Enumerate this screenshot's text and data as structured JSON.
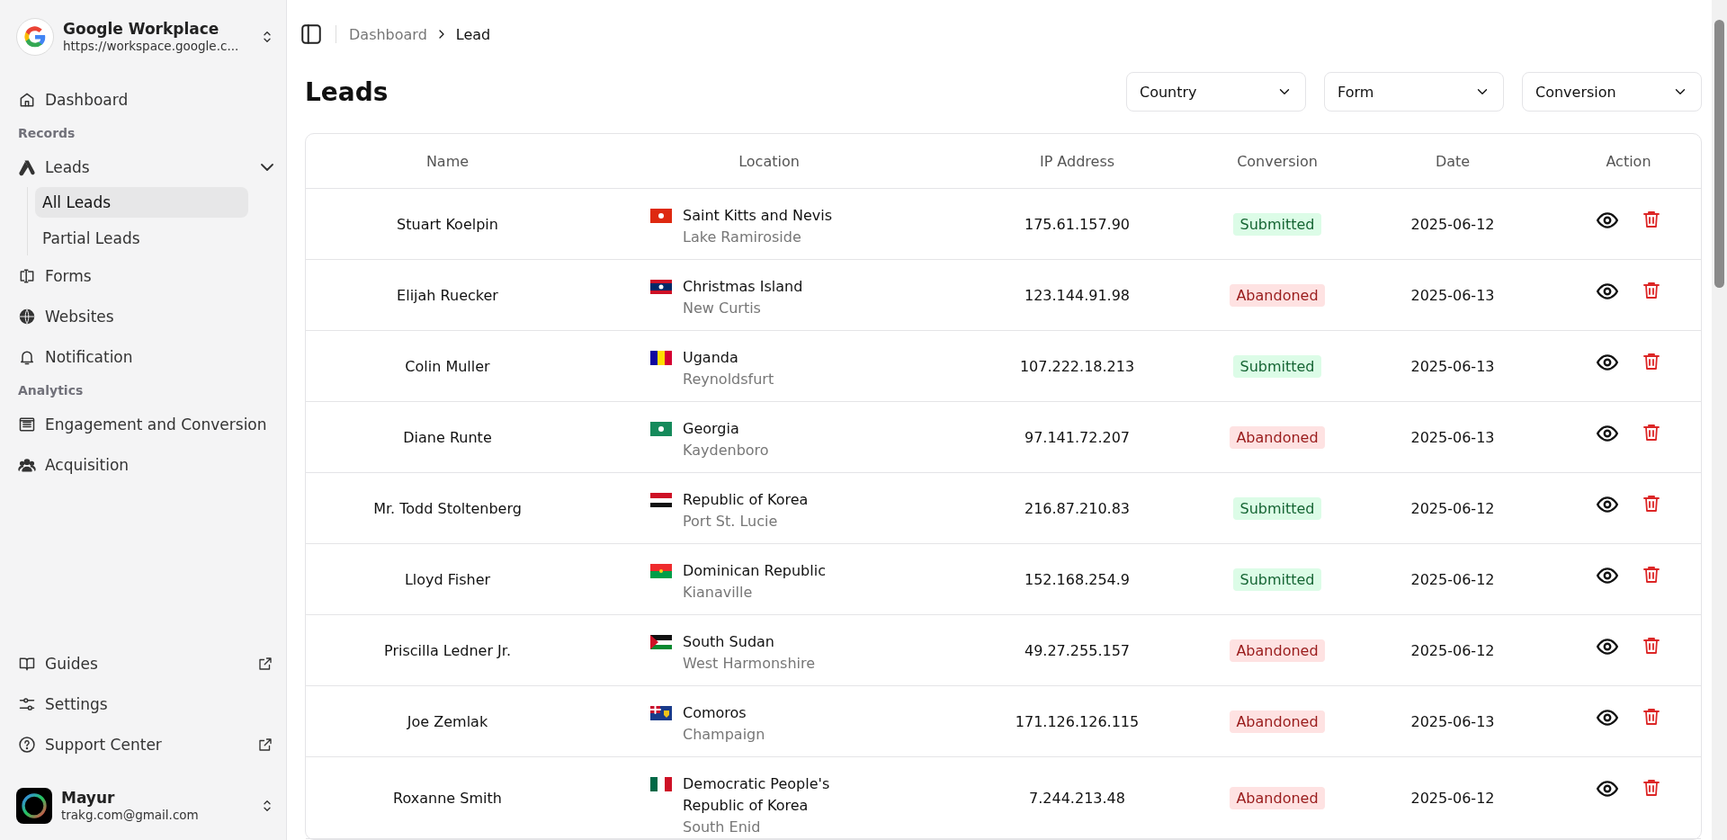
{
  "workspace": {
    "name": "Google Workplace",
    "url": "https://workspace.google.c..."
  },
  "nav": [
    {
      "kind": "item",
      "label": "Dashboard",
      "selected": false
    },
    {
      "kind": "section",
      "label": "Records"
    },
    {
      "kind": "group",
      "label": "Leads",
      "expanded": true,
      "children": [
        {
          "label": "All Leads",
          "selected": true
        },
        {
          "label": "Partial Leads",
          "selected": false
        }
      ]
    },
    {
      "kind": "item",
      "label": "Forms",
      "selected": false
    },
    {
      "kind": "item",
      "label": "Websites",
      "selected": false
    },
    {
      "kind": "item",
      "label": "Notification",
      "selected": false
    },
    {
      "kind": "section",
      "label": "Analytics"
    },
    {
      "kind": "item",
      "label": "Engagement and Conversion",
      "selected": false
    },
    {
      "kind": "item",
      "label": "Acquisition",
      "selected": false
    }
  ],
  "footer_nav": [
    {
      "label": "Guides",
      "external": true
    },
    {
      "label": "Settings",
      "external": false
    },
    {
      "label": "Support Center",
      "external": true
    }
  ],
  "user": {
    "name": "Mayur",
    "email": "trakg.com@gmail.com"
  },
  "breadcrumb": [
    "Dashboard",
    "Lead"
  ],
  "page_title": "Leads",
  "filters": [
    {
      "label": "Country"
    },
    {
      "label": "Form"
    },
    {
      "label": "Conversion"
    }
  ],
  "table": {
    "columns": [
      "Name",
      "Location",
      "IP Address",
      "Conversion",
      "Date",
      "Action"
    ],
    "rows": [
      {
        "name": "Stuart Koelpin",
        "country": "Saint Kitts and Nevis",
        "city": "Lake Ramiroside",
        "ip": "175.61.157.90",
        "conversion": {
          "label": "Submitted",
          "kind": "submitted"
        },
        "date": "2025-06-12"
      },
      {
        "name": "Elijah Ruecker",
        "country": "Christmas Island",
        "city": "New Curtis",
        "ip": "123.144.91.98",
        "conversion": {
          "label": "Abandoned",
          "kind": "abandoned"
        },
        "date": "2025-06-13"
      },
      {
        "name": "Colin Muller",
        "country": "Uganda",
        "city": "Reynoldsfurt",
        "ip": "107.222.18.213",
        "conversion": {
          "label": "Submitted",
          "kind": "submitted"
        },
        "date": "2025-06-13"
      },
      {
        "name": "Diane Runte",
        "country": "Georgia",
        "city": "Kaydenboro",
        "ip": "97.141.72.207",
        "conversion": {
          "label": "Abandoned",
          "kind": "abandoned"
        },
        "date": "2025-06-13"
      },
      {
        "name": "Mr. Todd Stoltenberg",
        "country": "Republic of Korea",
        "city": "Port St. Lucie",
        "ip": "216.87.210.83",
        "conversion": {
          "label": "Submitted",
          "kind": "submitted"
        },
        "date": "2025-06-12"
      },
      {
        "name": "Lloyd Fisher",
        "country": "Dominican Republic",
        "city": "Kianaville",
        "ip": "152.168.254.9",
        "conversion": {
          "label": "Submitted",
          "kind": "submitted"
        },
        "date": "2025-06-12"
      },
      {
        "name": "Priscilla Ledner Jr.",
        "country": "South Sudan",
        "city": "West Harmonshire",
        "ip": "49.27.255.157",
        "conversion": {
          "label": "Abandoned",
          "kind": "abandoned"
        },
        "date": "2025-06-12"
      },
      {
        "name": "Joe Zemlak",
        "country": "Comoros",
        "city": "Champaign",
        "ip": "171.126.126.115",
        "conversion": {
          "label": "Abandoned",
          "kind": "abandoned"
        },
        "date": "2025-06-13"
      },
      {
        "name": "Roxanne Smith",
        "country": "Democratic People's Republic of Korea",
        "city": "South Enid",
        "ip": "7.244.213.48",
        "conversion": {
          "label": "Abandoned",
          "kind": "abandoned"
        },
        "date": "2025-06-12"
      }
    ]
  }
}
